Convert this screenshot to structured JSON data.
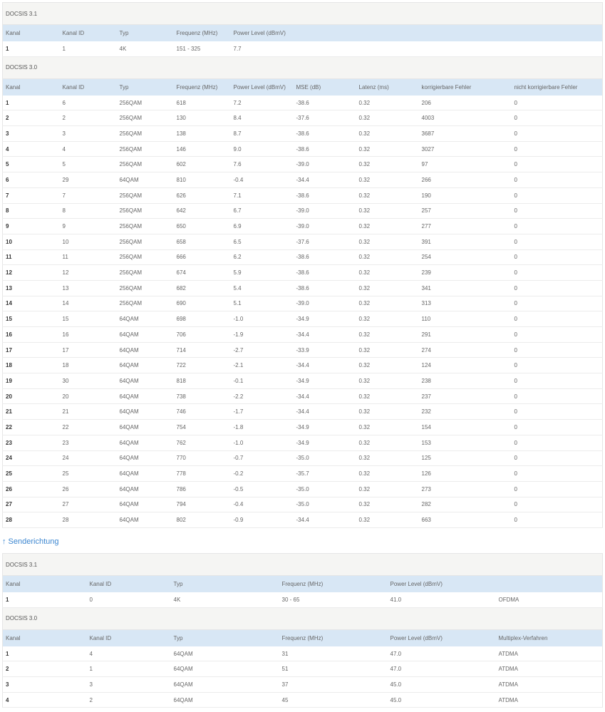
{
  "downstream": {
    "d31": {
      "title": "DOCSIS 3.1",
      "columns": [
        "Kanal",
        "Kanal ID",
        "Typ",
        "Frequenz (MHz)",
        "Power Level (dBmV)",
        "",
        "",
        "",
        ""
      ],
      "rows": [
        [
          "1",
          "1",
          "4K",
          "151 - 325",
          "7.7",
          "",
          "",
          "",
          ""
        ]
      ]
    },
    "d30": {
      "title": "DOCSIS 3.0",
      "columns": [
        "Kanal",
        "Kanal ID",
        "Typ",
        "Frequenz (MHz)",
        "Power Level (dBmV)",
        "MSE (dB)",
        "Latenz (ms)",
        "korrigierbare Fehler",
        "nicht korrigierbare Fehler"
      ],
      "rows": [
        [
          "1",
          "6",
          "256QAM",
          "618",
          "7.2",
          "-38.6",
          "0.32",
          "206",
          "0"
        ],
        [
          "2",
          "2",
          "256QAM",
          "130",
          "8.4",
          "-37.6",
          "0.32",
          "4003",
          "0"
        ],
        [
          "3",
          "3",
          "256QAM",
          "138",
          "8.7",
          "-38.6",
          "0.32",
          "3687",
          "0"
        ],
        [
          "4",
          "4",
          "256QAM",
          "146",
          "9.0",
          "-38.6",
          "0.32",
          "3027",
          "0"
        ],
        [
          "5",
          "5",
          "256QAM",
          "602",
          "7.6",
          "-39.0",
          "0.32",
          "97",
          "0"
        ],
        [
          "6",
          "29",
          "64QAM",
          "810",
          "-0.4",
          "-34.4",
          "0.32",
          "266",
          "0"
        ],
        [
          "7",
          "7",
          "256QAM",
          "626",
          "7.1",
          "-38.6",
          "0.32",
          "190",
          "0"
        ],
        [
          "8",
          "8",
          "256QAM",
          "642",
          "6.7",
          "-39.0",
          "0.32",
          "257",
          "0"
        ],
        [
          "9",
          "9",
          "256QAM",
          "650",
          "6.9",
          "-39.0",
          "0.32",
          "277",
          "0"
        ],
        [
          "10",
          "10",
          "256QAM",
          "658",
          "6.5",
          "-37.6",
          "0.32",
          "391",
          "0"
        ],
        [
          "11",
          "11",
          "256QAM",
          "666",
          "6.2",
          "-38.6",
          "0.32",
          "254",
          "0"
        ],
        [
          "12",
          "12",
          "256QAM",
          "674",
          "5.9",
          "-38.6",
          "0.32",
          "239",
          "0"
        ],
        [
          "13",
          "13",
          "256QAM",
          "682",
          "5.4",
          "-38.6",
          "0.32",
          "341",
          "0"
        ],
        [
          "14",
          "14",
          "256QAM",
          "690",
          "5.1",
          "-39.0",
          "0.32",
          "313",
          "0"
        ],
        [
          "15",
          "15",
          "64QAM",
          "698",
          "-1.0",
          "-34.9",
          "0.32",
          "110",
          "0"
        ],
        [
          "16",
          "16",
          "64QAM",
          "706",
          "-1.9",
          "-34.4",
          "0.32",
          "291",
          "0"
        ],
        [
          "17",
          "17",
          "64QAM",
          "714",
          "-2.7",
          "-33.9",
          "0.32",
          "274",
          "0"
        ],
        [
          "18",
          "18",
          "64QAM",
          "722",
          "-2.1",
          "-34.4",
          "0.32",
          "124",
          "0"
        ],
        [
          "19",
          "30",
          "64QAM",
          "818",
          "-0.1",
          "-34.9",
          "0.32",
          "238",
          "0"
        ],
        [
          "20",
          "20",
          "64QAM",
          "738",
          "-2.2",
          "-34.4",
          "0.32",
          "237",
          "0"
        ],
        [
          "21",
          "21",
          "64QAM",
          "746",
          "-1.7",
          "-34.4",
          "0.32",
          "232",
          "0"
        ],
        [
          "22",
          "22",
          "64QAM",
          "754",
          "-1.8",
          "-34.9",
          "0.32",
          "154",
          "0"
        ],
        [
          "23",
          "23",
          "64QAM",
          "762",
          "-1.0",
          "-34.9",
          "0.32",
          "153",
          "0"
        ],
        [
          "24",
          "24",
          "64QAM",
          "770",
          "-0.7",
          "-35.0",
          "0.32",
          "125",
          "0"
        ],
        [
          "25",
          "25",
          "64QAM",
          "778",
          "-0.2",
          "-35.7",
          "0.32",
          "126",
          "0"
        ],
        [
          "26",
          "26",
          "64QAM",
          "786",
          "-0.5",
          "-35.0",
          "0.32",
          "273",
          "0"
        ],
        [
          "27",
          "27",
          "64QAM",
          "794",
          "-0.4",
          "-35.0",
          "0.32",
          "282",
          "0"
        ],
        [
          "28",
          "28",
          "64QAM",
          "802",
          "-0.9",
          "-34.4",
          "0.32",
          "663",
          "0"
        ]
      ]
    }
  },
  "upstream": {
    "label": "↑ Senderichtung",
    "accent_color": "#3b86d0",
    "d31": {
      "title": "DOCSIS 3.1",
      "columns": [
        "Kanal",
        "Kanal ID",
        "Typ",
        "Frequenz (MHz)",
        "Power Level (dBmV)",
        ""
      ],
      "rows": [
        [
          "1",
          "0",
          "4K",
          "30 - 65",
          "41.0",
          "OFDMA"
        ]
      ]
    },
    "d30": {
      "title": "DOCSIS 3.0",
      "columns": [
        "Kanal",
        "Kanal ID",
        "Typ",
        "Frequenz (MHz)",
        "Power Level (dBmV)",
        "Multiplex-Verfahren"
      ],
      "rows": [
        [
          "1",
          "4",
          "64QAM",
          "31",
          "47.0",
          "ATDMA"
        ],
        [
          "2",
          "1",
          "64QAM",
          "51",
          "47.0",
          "ATDMA"
        ],
        [
          "3",
          "3",
          "64QAM",
          "37",
          "45.0",
          "ATDMA"
        ],
        [
          "4",
          "2",
          "64QAM",
          "45",
          "45.0",
          "ATDMA"
        ]
      ]
    }
  }
}
